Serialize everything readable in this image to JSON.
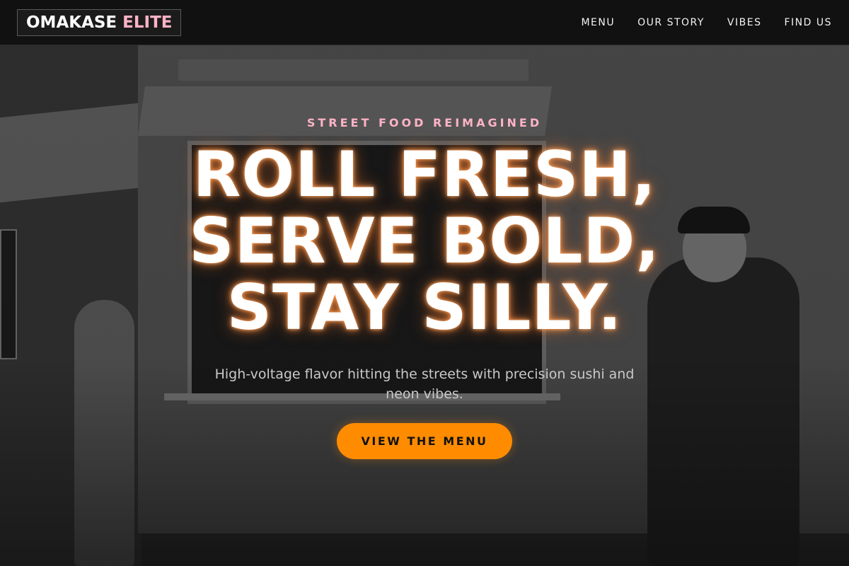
{
  "logo": {
    "part1": "OMAKASE",
    "part2": "ELITE"
  },
  "nav": {
    "items": [
      "MENU",
      "OUR STORY",
      "VIBES",
      "FIND US"
    ]
  },
  "hero": {
    "eyebrow": "STREET FOOD REIMAGINED",
    "headline_lines": [
      "ROLL FRESH,",
      "SERVE BOLD,",
      "STAY SILLY."
    ],
    "subhead": "High-voltage flavor hitting the streets with precision sushi and neon vibes.",
    "cta_label": "VIEW THE MENU"
  },
  "colors": {
    "accent_orange": "#ff8c00",
    "accent_pink": "#ffb3c6",
    "navbar_bg": "#111111",
    "headline_glow": "#ff9646"
  }
}
